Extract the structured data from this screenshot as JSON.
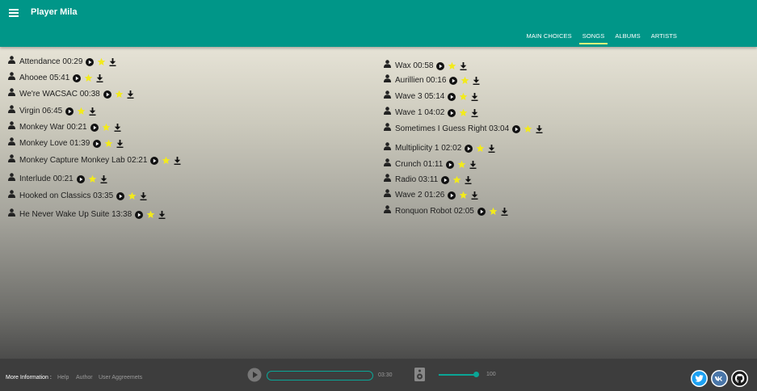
{
  "app": {
    "title": "Player Mila"
  },
  "nav": {
    "tabs": [
      {
        "label": "MAIN CHOICES",
        "active": false
      },
      {
        "label": "SONGS",
        "active": true
      },
      {
        "label": "ALBUMS",
        "active": false
      },
      {
        "label": "ARTISTS",
        "active": false
      }
    ]
  },
  "songs_left": [
    {
      "title": "Attendance",
      "duration": "00:29"
    },
    {
      "title": "Ahooee",
      "duration": "05:41"
    },
    {
      "title": "We're WACSAC",
      "duration": "00:38"
    },
    {
      "title": "Virgin",
      "duration": "06:45"
    },
    {
      "title": "Monkey War",
      "duration": "00:21"
    },
    {
      "title": "Monkey Love",
      "duration": "01:39"
    },
    {
      "title": "Monkey Capture Monkey Lab",
      "duration": "02:21"
    },
    {
      "title": "Interlude",
      "duration": "00:21"
    },
    {
      "title": "Hooked on Classics",
      "duration": "03:35"
    },
    {
      "title": "He Never Wake Up Suite",
      "duration": "13:38"
    }
  ],
  "songs_right": [
    {
      "title": "Wax",
      "duration": "00:58"
    },
    {
      "title": "Aurillien",
      "duration": "00:16"
    },
    {
      "title": "Wave 3",
      "duration": "05:14"
    },
    {
      "title": "Wave 1",
      "duration": "04:02"
    },
    {
      "title": "Sometimes I Guess Right",
      "duration": "03:04"
    },
    {
      "title": "Multiplicity 1",
      "duration": "02:02"
    },
    {
      "title": "Crunch",
      "duration": "01:11"
    },
    {
      "title": "Radio",
      "duration": "03:11"
    },
    {
      "title": "Wave 2",
      "duration": "01:26"
    },
    {
      "title": "Ronquon Robot",
      "duration": "02:05"
    }
  ],
  "footer": {
    "more_info": "More Information :",
    "links": [
      "Help",
      "Author",
      "User Aggreemets"
    ],
    "total_time": "03:30",
    "progress": 0,
    "volume": "100",
    "social": [
      "twitter-icon",
      "vk-icon",
      "github-icon"
    ]
  },
  "colors": {
    "primary": "#009688",
    "tab_underline": "#e8f57a",
    "star": "#f2ea1c",
    "footer_bg": "#3d3d3d",
    "twitter": "#1da1f2",
    "vk": "#4a76a8"
  }
}
